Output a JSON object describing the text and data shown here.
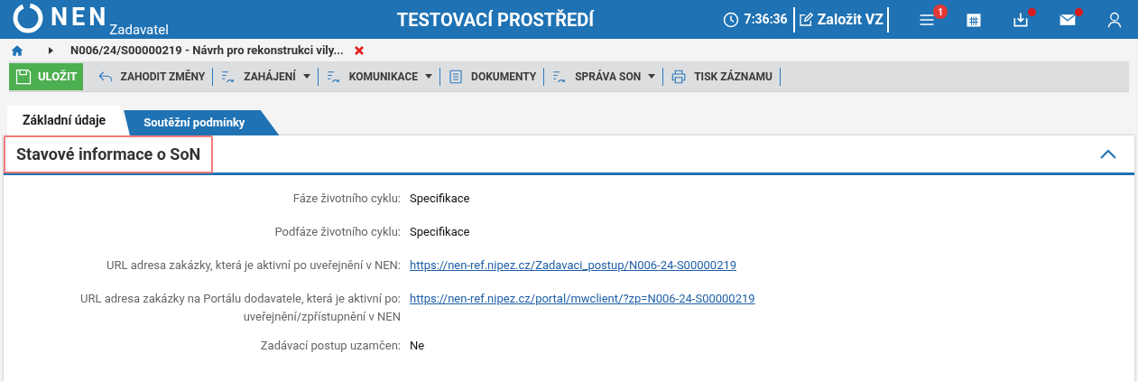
{
  "header": {
    "logo": "NEN",
    "subtitle": "Zadavatel",
    "title": "TESTOVACÍ PROSTŘEDÍ",
    "time": "7:36:36",
    "create_button": "Založit VZ",
    "icons": [
      {
        "kind": "menu",
        "badge": "1",
        "dot": false
      },
      {
        "kind": "calendar",
        "dot": false
      },
      {
        "kind": "inbox",
        "dot": true
      },
      {
        "kind": "mail",
        "dot": true
      },
      {
        "kind": "user",
        "dot": false
      }
    ]
  },
  "breadcrumb": {
    "item": "N006/24/S00000219 - Návrh pro rekonstrukci vily..."
  },
  "toolbar": [
    {
      "kind": "save",
      "label": "ULOŽIT",
      "dropdown": false
    },
    {
      "kind": "undo",
      "label": "ZAHODIT ZMĚNY",
      "dropdown": false
    },
    {
      "kind": "flow",
      "label": "ZAHÁJENÍ",
      "dropdown": true
    },
    {
      "kind": "flow",
      "label": "KOMUNIKACE",
      "dropdown": true
    },
    {
      "kind": "doc",
      "label": "DOKUMENTY",
      "dropdown": false
    },
    {
      "kind": "flow",
      "label": "SPRÁVA SON",
      "dropdown": true
    },
    {
      "kind": "print",
      "label": "TISK ZÁZNAMU",
      "dropdown": false
    }
  ],
  "tabs": [
    {
      "label": "Základní údaje",
      "selected": true
    },
    {
      "label": "Soutěžní podmínky",
      "selected": false
    }
  ],
  "panel": {
    "title": "Stavové informace o SoN",
    "expanded": true,
    "rows": [
      {
        "label": "Fáze životního cyklu:",
        "value": "Specifikace",
        "kind": "text"
      },
      {
        "label": "Podfáze životního cyklu:",
        "value": "Specifikace",
        "kind": "text"
      },
      {
        "label": "URL adresa zakázky, která je aktivní po uveřejnění v NEN:",
        "value": "https://nen-ref.nipez.cz/Zadavaci_postup/N006-24-S00000219",
        "kind": "link"
      },
      {
        "label": "URL adresa zakázky na Portálu dodavatele, která je aktivní po: uveřejnění/zpřístupnění v NEN",
        "value": "https://nen-ref.nipez.cz/portal/mwclient/?zp=N006-24-S00000219",
        "kind": "link"
      },
      {
        "label": "Zadávací postup uzamčen:",
        "value": "Ne",
        "kind": "text"
      }
    ]
  }
}
